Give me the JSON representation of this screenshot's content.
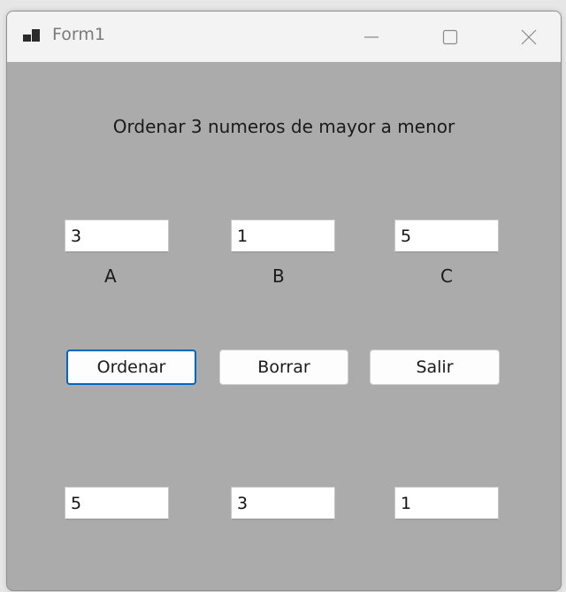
{
  "window": {
    "title": "Form1"
  },
  "form": {
    "heading": "Ordenar 3 numeros de mayor a menor",
    "inputs": {
      "a": "3",
      "b": "1",
      "c": "5"
    },
    "labels": {
      "a": "A",
      "b": "B",
      "c": "C"
    },
    "buttons": {
      "ordenar": "Ordenar",
      "borrar": "Borrar",
      "salir": "Salir"
    },
    "results": {
      "first": "5",
      "second": "3",
      "third": "1"
    }
  },
  "colors": {
    "form_background": "#ababab",
    "titlebar": "#f3f3f3",
    "focus_accent": "#0067c0"
  },
  "icons": [
    "app-form-icon",
    "minimize-icon",
    "maximize-icon",
    "close-icon"
  ]
}
